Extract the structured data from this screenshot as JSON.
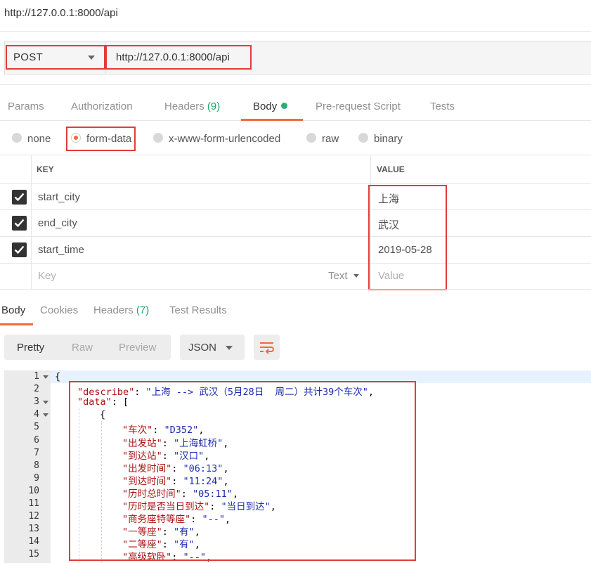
{
  "title_url": "http://127.0.0.1:8000/api",
  "request": {
    "method": "POST",
    "url": "http://127.0.0.1:8000/api"
  },
  "request_tabs": {
    "params": "Params",
    "authorization": "Authorization",
    "headers": "Headers",
    "headers_count": "(9)",
    "body": "Body",
    "prerequest": "Pre-request Script",
    "tests": "Tests"
  },
  "body_types": {
    "none": "none",
    "form_data": "form-data",
    "urlencoded": "x-www-form-urlencoded",
    "raw": "raw",
    "binary": "binary",
    "selected": "form-data"
  },
  "params_table": {
    "key_header": "KEY",
    "value_header": "VALUE",
    "rows": [
      {
        "key": "start_city",
        "value": "上海",
        "checked": true
      },
      {
        "key": "end_city",
        "value": "武汉",
        "checked": true
      },
      {
        "key": "start_time",
        "value": "2019-05-28",
        "checked": true
      }
    ],
    "key_placeholder": "Key",
    "value_placeholder": "Value",
    "type_label": "Text"
  },
  "response_tabs": {
    "body": "Body",
    "cookies": "Cookies",
    "headers": "Headers",
    "headers_count": "(7)",
    "test_results": "Test Results"
  },
  "view": {
    "pretty": "Pretty",
    "raw": "Raw",
    "preview": "Preview",
    "format": "JSON"
  },
  "code_lines": [
    {
      "n": "1",
      "fold": true
    },
    {
      "n": "2",
      "key": "describe",
      "val": "上海 --> 武汉（5月28日  周二）共计39个车次"
    },
    {
      "n": "3",
      "fold": true,
      "key": "data"
    },
    {
      "n": "4",
      "fold": true
    },
    {
      "n": "5",
      "key": "车次",
      "val": "D352"
    },
    {
      "n": "6",
      "key": "出发站",
      "val": "上海虹桥"
    },
    {
      "n": "7",
      "key": "到达站",
      "val": "汉口"
    },
    {
      "n": "8",
      "key": "出发时间",
      "val": "06:13"
    },
    {
      "n": "9",
      "key": "到达时间",
      "val": "11:24"
    },
    {
      "n": "10",
      "key": "历时总时间",
      "val": "05:11"
    },
    {
      "n": "11",
      "key": "历时是否当日到达",
      "val": "当日到达"
    },
    {
      "n": "12",
      "key": "商务座特等座",
      "val": "--"
    },
    {
      "n": "13",
      "key": "一等座",
      "val": "有"
    },
    {
      "n": "14",
      "key": "二等座",
      "val": "有"
    },
    {
      "n": "15",
      "key": "高级软卧",
      "val": "--"
    }
  ]
}
